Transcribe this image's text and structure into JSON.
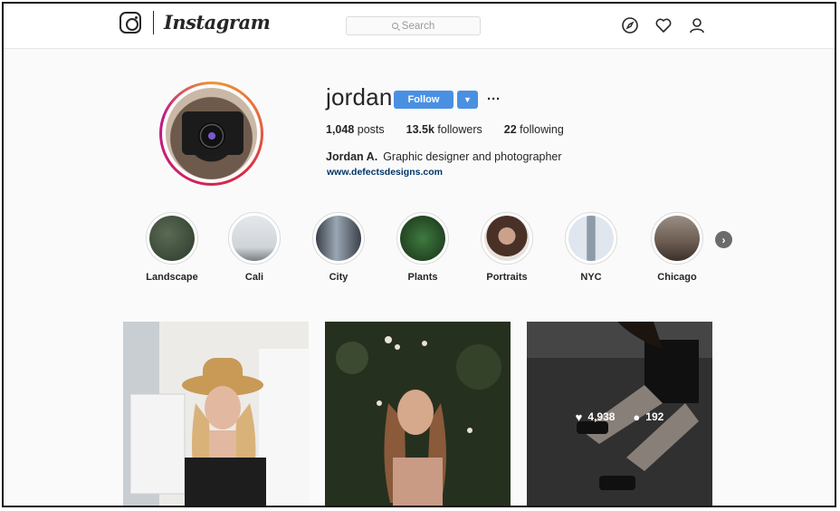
{
  "app": {
    "wordmark": "Instagram"
  },
  "search": {
    "placeholder": "Search"
  },
  "nav": {
    "icons": [
      "compass-icon",
      "heart-icon",
      "profile-icon"
    ]
  },
  "profile": {
    "username": "jordan",
    "follow_label": "Follow",
    "dropdown_glyph": "▼",
    "more_glyph": "···",
    "stats": [
      {
        "value": "1,048",
        "label": "posts"
      },
      {
        "value": "13.5k",
        "label": "followers"
      },
      {
        "value": "22",
        "label": "following"
      }
    ],
    "full_name": "Jordan A.",
    "bio": "Graphic designer and photographer",
    "website": "www.defectsdesigns.com"
  },
  "highlights": [
    {
      "label": "Landscape",
      "color": "#3e4a3a"
    },
    {
      "label": "Cali",
      "color": "#d9dde1"
    },
    {
      "label": "City",
      "color": "#6c7480"
    },
    {
      "label": "Plants",
      "color": "#1f3a22"
    },
    {
      "label": "Portraits",
      "color": "#8a6a5a"
    },
    {
      "label": "NYC",
      "color": "#cfd8e2"
    },
    {
      "label": "Chicago",
      "color": "#7a6a60"
    }
  ],
  "posts": [
    {
      "likes": "",
      "comments": ""
    },
    {
      "likes": "",
      "comments": ""
    },
    {
      "likes": "4,938",
      "comments": "192"
    }
  ],
  "colors": {
    "accent": "#4a90e2",
    "link": "#003569"
  }
}
